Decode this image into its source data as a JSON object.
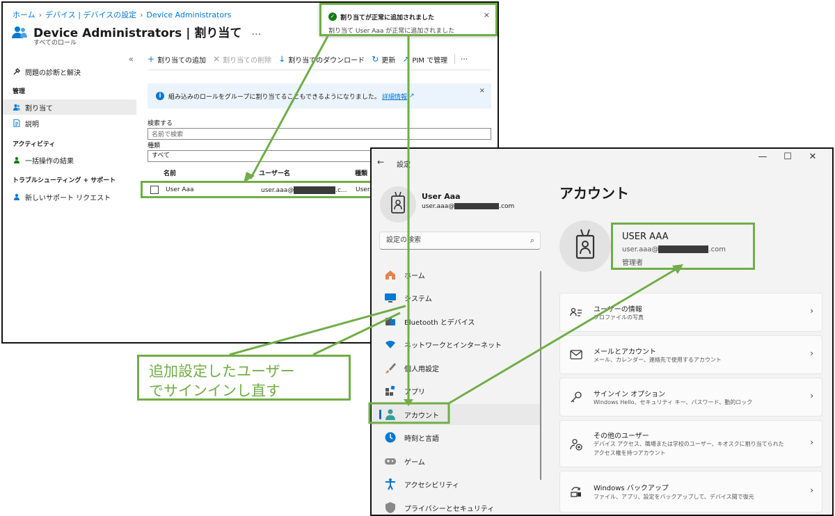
{
  "azure": {
    "breadcrumb": [
      "ホーム",
      "デバイス | デバイスの設定",
      "Device Administrators"
    ],
    "title": "Device Administrators | 割り当て",
    "title_more": "…",
    "subtitle": "すべてのロール",
    "collapse": "«",
    "nav": {
      "diagnose": "問題の診断と解決",
      "section_manage": "管理",
      "assignments": "割り当て",
      "description": "説明",
      "section_activity": "アクティビティ",
      "bulk_results": "一括操作の結果",
      "section_support": "トラブルシューティング + サポート",
      "new_support": "新しいサポート リクエスト"
    },
    "toolbar": {
      "add": "割り当ての追加",
      "remove": "割り当ての削除",
      "download": "割り当てのダウンロード",
      "refresh": "更新",
      "pim": "PIM で管理",
      "more": "⋯"
    },
    "info": {
      "text": "組み込みのロールをグループに割り当てることもできるようになりました。",
      "link": "詳細情報",
      "close": "×"
    },
    "search": {
      "label": "検索する",
      "placeholder": "名前で検索"
    },
    "type": {
      "label": "種類",
      "value": "すべて"
    },
    "columns": [
      "名前",
      "ユーザー名",
      "種類"
    ],
    "row": {
      "name": "User Aaa",
      "username_prefix": "user.aaa@",
      "username_suffix": ".c...",
      "type": "User"
    }
  },
  "toast": {
    "title": "割り当てが正常に追加されました",
    "body": "割り当て User Aaa が正常に追加されました",
    "close": "×"
  },
  "settings": {
    "back": "←",
    "title": "設定",
    "window_buttons": [
      "—",
      "☐",
      "✕"
    ],
    "user_name": "User Aaa",
    "user_mail_prefix": "user.aaa@",
    "user_mail_suffix": ".com",
    "search_placeholder": "設定の検索",
    "search_icon": "search-icon",
    "nav": [
      "ホーム",
      "システム",
      "Bluetooth とデバイス",
      "ネットワークとインターネット",
      "個人用設定",
      "アプリ",
      "アカウント",
      "時刻と言語",
      "ゲーム",
      "アクセシビリティ",
      "プライバシーとセキュリティ"
    ],
    "active_nav": "アカウント",
    "heading": "アカウント",
    "profile": {
      "name": "USER AAA",
      "mail_prefix": "user.aaa@",
      "mail_suffix": ".com",
      "role": "管理者"
    },
    "cards": [
      {
        "title": "ユーザーの情報",
        "subtitle": "プロファイルの写真"
      },
      {
        "title": "メールとアカウント",
        "subtitle": "メール、カレンダー、連絡先で使用するアカウント"
      },
      {
        "title": "サインイン オプション",
        "subtitle": "Windows Hello、セキュリティ キー、パスワード、動的ロック"
      },
      {
        "title": "その他のユーザー",
        "subtitle": "デバイス アクセス、職場または学校のユーザー、キオスクに割り当てられた",
        "subtitle2": "アクセス権を持つアカウント"
      },
      {
        "title": "Windows バックアップ",
        "subtitle": "ファイル、アプリ、設定をバックアップして、デバイス間で復元"
      }
    ],
    "chevron": "›"
  },
  "callout": {
    "line1": "追加設定したユーザー",
    "line2": "でサインインし直す"
  },
  "colors": {
    "highlight": "#70ad47",
    "accent": "#0078d4",
    "redaction": "#3a3a3a"
  }
}
